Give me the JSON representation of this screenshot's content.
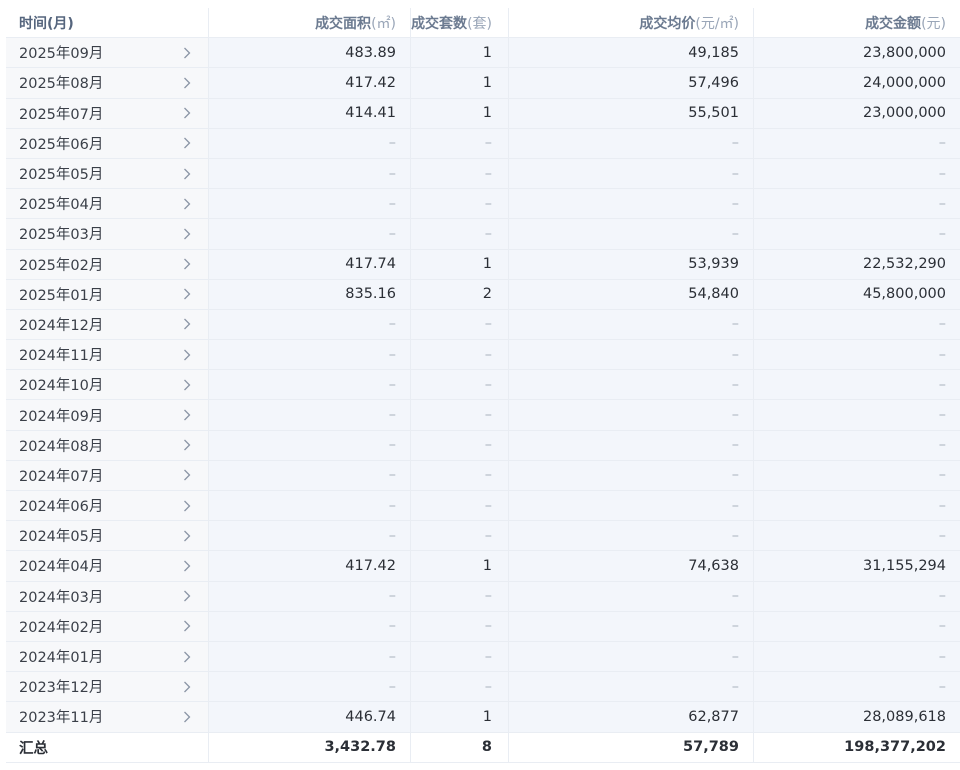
{
  "headers": {
    "time": {
      "label": "时间(月)",
      "unit": ""
    },
    "area": {
      "label": "成交面积",
      "unit": "(㎡)"
    },
    "units": {
      "label": "成交套数",
      "unit": "(套)"
    },
    "price": {
      "label": "成交均价",
      "unit": "(元/㎡)"
    },
    "amount": {
      "label": "成交金额",
      "unit": "(元)"
    }
  },
  "rows": [
    {
      "month": "2025年09月",
      "area": "483.89",
      "units": "1",
      "price": "49,185",
      "amount": "23,800,000"
    },
    {
      "month": "2025年08月",
      "area": "417.42",
      "units": "1",
      "price": "57,496",
      "amount": "24,000,000"
    },
    {
      "month": "2025年07月",
      "area": "414.41",
      "units": "1",
      "price": "55,501",
      "amount": "23,000,000"
    },
    {
      "month": "2025年06月",
      "area": "–",
      "units": "–",
      "price": "–",
      "amount": "–"
    },
    {
      "month": "2025年05月",
      "area": "–",
      "units": "–",
      "price": "–",
      "amount": "–"
    },
    {
      "month": "2025年04月",
      "area": "–",
      "units": "–",
      "price": "–",
      "amount": "–"
    },
    {
      "month": "2025年03月",
      "area": "–",
      "units": "–",
      "price": "–",
      "amount": "–"
    },
    {
      "month": "2025年02月",
      "area": "417.74",
      "units": "1",
      "price": "53,939",
      "amount": "22,532,290"
    },
    {
      "month": "2025年01月",
      "area": "835.16",
      "units": "2",
      "price": "54,840",
      "amount": "45,800,000"
    },
    {
      "month": "2024年12月",
      "area": "–",
      "units": "–",
      "price": "–",
      "amount": "–"
    },
    {
      "month": "2024年11月",
      "area": "–",
      "units": "–",
      "price": "–",
      "amount": "–"
    },
    {
      "month": "2024年10月",
      "area": "–",
      "units": "–",
      "price": "–",
      "amount": "–"
    },
    {
      "month": "2024年09月",
      "area": "–",
      "units": "–",
      "price": "–",
      "amount": "–"
    },
    {
      "month": "2024年08月",
      "area": "–",
      "units": "–",
      "price": "–",
      "amount": "–"
    },
    {
      "month": "2024年07月",
      "area": "–",
      "units": "–",
      "price": "–",
      "amount": "–"
    },
    {
      "month": "2024年06月",
      "area": "–",
      "units": "–",
      "price": "–",
      "amount": "–"
    },
    {
      "month": "2024年05月",
      "area": "–",
      "units": "–",
      "price": "–",
      "amount": "–"
    },
    {
      "month": "2024年04月",
      "area": "417.42",
      "units": "1",
      "price": "74,638",
      "amount": "31,155,294"
    },
    {
      "month": "2024年03月",
      "area": "–",
      "units": "–",
      "price": "–",
      "amount": "–"
    },
    {
      "month": "2024年02月",
      "area": "–",
      "units": "–",
      "price": "–",
      "amount": "–"
    },
    {
      "month": "2024年01月",
      "area": "–",
      "units": "–",
      "price": "–",
      "amount": "–"
    },
    {
      "month": "2023年12月",
      "area": "–",
      "units": "–",
      "price": "–",
      "amount": "–"
    },
    {
      "month": "2023年11月",
      "area": "446.74",
      "units": "1",
      "price": "62,877",
      "amount": "28,089,618"
    }
  ],
  "total": {
    "label": "汇总",
    "area": "3,432.78",
    "units": "8",
    "price": "57,789",
    "amount": "198,377,202"
  }
}
